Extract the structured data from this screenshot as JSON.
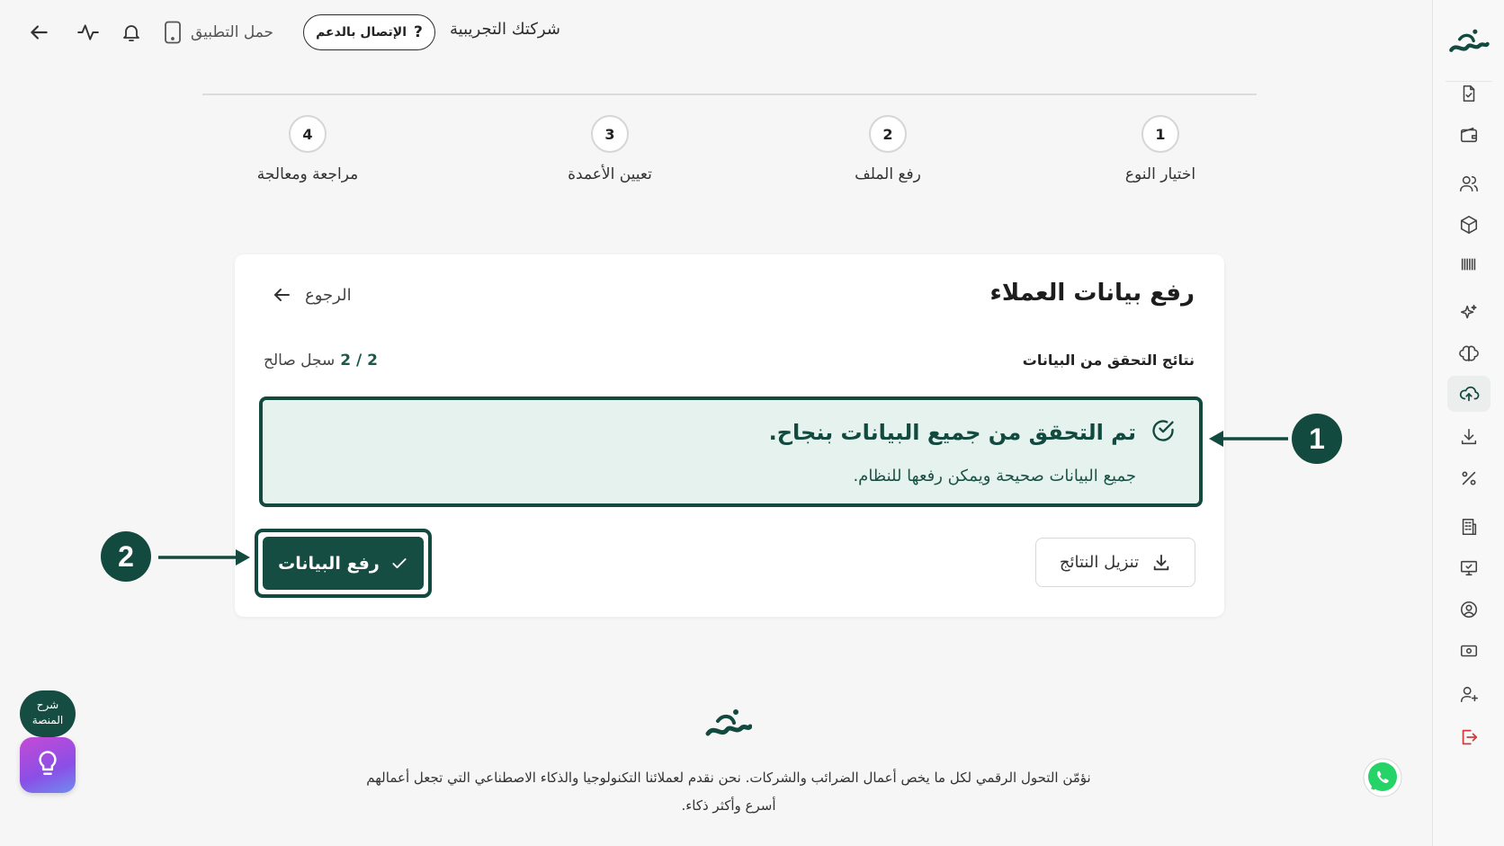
{
  "topbar": {
    "company": "شركتك التجريبية",
    "support_label": "الإتصال بالدعم",
    "app_label": "حمل التطبيق"
  },
  "stepper": [
    {
      "number": "1",
      "label": "اختيار النوع"
    },
    {
      "number": "2",
      "label": "رفع الملف"
    },
    {
      "number": "3",
      "label": "تعيين الأعمدة"
    },
    {
      "number": "4",
      "label": "مراجعة ومعالجة"
    }
  ],
  "card": {
    "title": "رفع بيانات العملاء",
    "back_label": "الرجوع",
    "section_label": "نتائج التحقق من البيانات",
    "valid_count": "2 / 2",
    "valid_label": "سجل صالح",
    "alert_title": "تم التحقق من جميع البيانات بنجاح.",
    "alert_sub": "جميع البيانات صحيحة ويمكن رفعها للنظام.",
    "download_label": "تنزيل النتائج",
    "upload_label": "رفع البيانات"
  },
  "annotations": {
    "marker1": "1",
    "marker2": "2"
  },
  "footer": {
    "line1": "نؤمّن التحول الرقمي لكل ما يخص أعمال الضرائب والشركات. نحن نقدم لعملائنا التكنولوجيا والذكاء الاصطناعي التي تجعل أعمالهم",
    "line2": "أسرع وأكثر ذكاء."
  },
  "help": {
    "pill_label": "شرح المنصة"
  },
  "colors": {
    "primary": "#164d42",
    "alert_bg": "#e6f2ee",
    "background": "#f6f6f6"
  },
  "icons": [
    "back-arrow-icon",
    "pulse-icon",
    "bell-icon",
    "phone-icon",
    "question-icon",
    "file-check-icon",
    "wallet-icon",
    "users-icon",
    "box-icon",
    "barcode-icon",
    "sparkles-icon",
    "brain-icon",
    "cloud-upload-icon",
    "download-icon",
    "percent-icon",
    "building-icon",
    "monitor-icon",
    "user-circle-icon",
    "money-icon",
    "user-plus-icon",
    "logout-icon",
    "check-circle-icon",
    "check-icon",
    "lightbulb-icon",
    "whatsapp-icon"
  ]
}
